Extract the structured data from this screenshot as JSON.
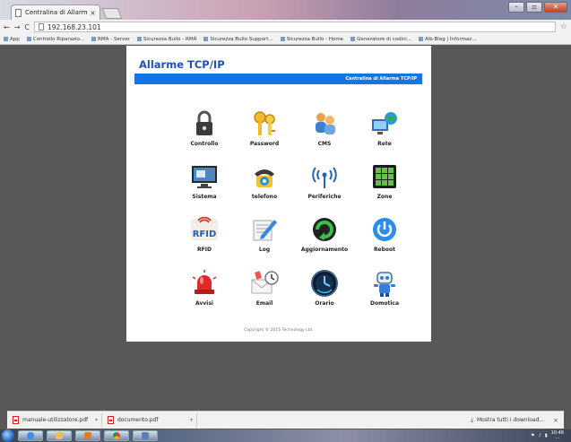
{
  "browser": {
    "tab_title": "Centralina di Allarme TCP",
    "tab_close": "×",
    "url": "192.168.23.101",
    "nav": {
      "back": "←",
      "forward": "→",
      "reload": "C"
    },
    "window_buttons": {
      "minimize": "–",
      "maximize": "▫",
      "close": "✕"
    },
    "bookmarks": [
      "App",
      "Controllo Riparazio...",
      "RMA - Server",
      "Sicurezza Bullo - RMA",
      "Sicurezza Bullo Support...",
      "Sicurezza Bullo - Home",
      "Generatore di codici...",
      "Alb Blog | Informaz..."
    ]
  },
  "page": {
    "app_title": "Allarme TCP/IP",
    "header_bar_text": "Centralina di Allarme TCP/IP",
    "tiles": [
      {
        "label": "Controllo",
        "icon": "padlock-icon"
      },
      {
        "label": "Password",
        "icon": "keys-icon"
      },
      {
        "label": "CMS",
        "icon": "cms-people-icon"
      },
      {
        "label": "Rete",
        "icon": "network-globe-icon"
      },
      {
        "label": "Sistema",
        "icon": "system-monitor-icon"
      },
      {
        "label": "telefono",
        "icon": "phone-icon"
      },
      {
        "label": "Periferiche",
        "icon": "wireless-signal-icon"
      },
      {
        "label": "Zone",
        "icon": "zones-grid-icon"
      },
      {
        "label": "RFID",
        "icon": "rfid-icon"
      },
      {
        "label": "Log",
        "icon": "log-pencil-icon"
      },
      {
        "label": "Aggiornamento",
        "icon": "update-arrow-icon"
      },
      {
        "label": "Reboot",
        "icon": "power-icon"
      },
      {
        "label": "Avvisi",
        "icon": "alarm-siren-icon"
      },
      {
        "label": "Email",
        "icon": "email-icon"
      },
      {
        "label": "Orario",
        "icon": "clock-icon"
      },
      {
        "label": "Domotica",
        "icon": "robot-icon"
      }
    ],
    "copyright": "Copyright © 2015 Technology Ltd."
  },
  "downloads": {
    "items": [
      {
        "name": "manuale-utilizzatore.pdf"
      },
      {
        "name": "documento.pdf"
      }
    ],
    "show_all": "Mostra tutti i download...",
    "close": "×"
  },
  "taskbar": {
    "clock_time": "10:48",
    "clock_date": "..."
  },
  "colors": {
    "accent_blue": "#1276e8",
    "title_blue": "#2050b8",
    "page_background": "#585858"
  }
}
